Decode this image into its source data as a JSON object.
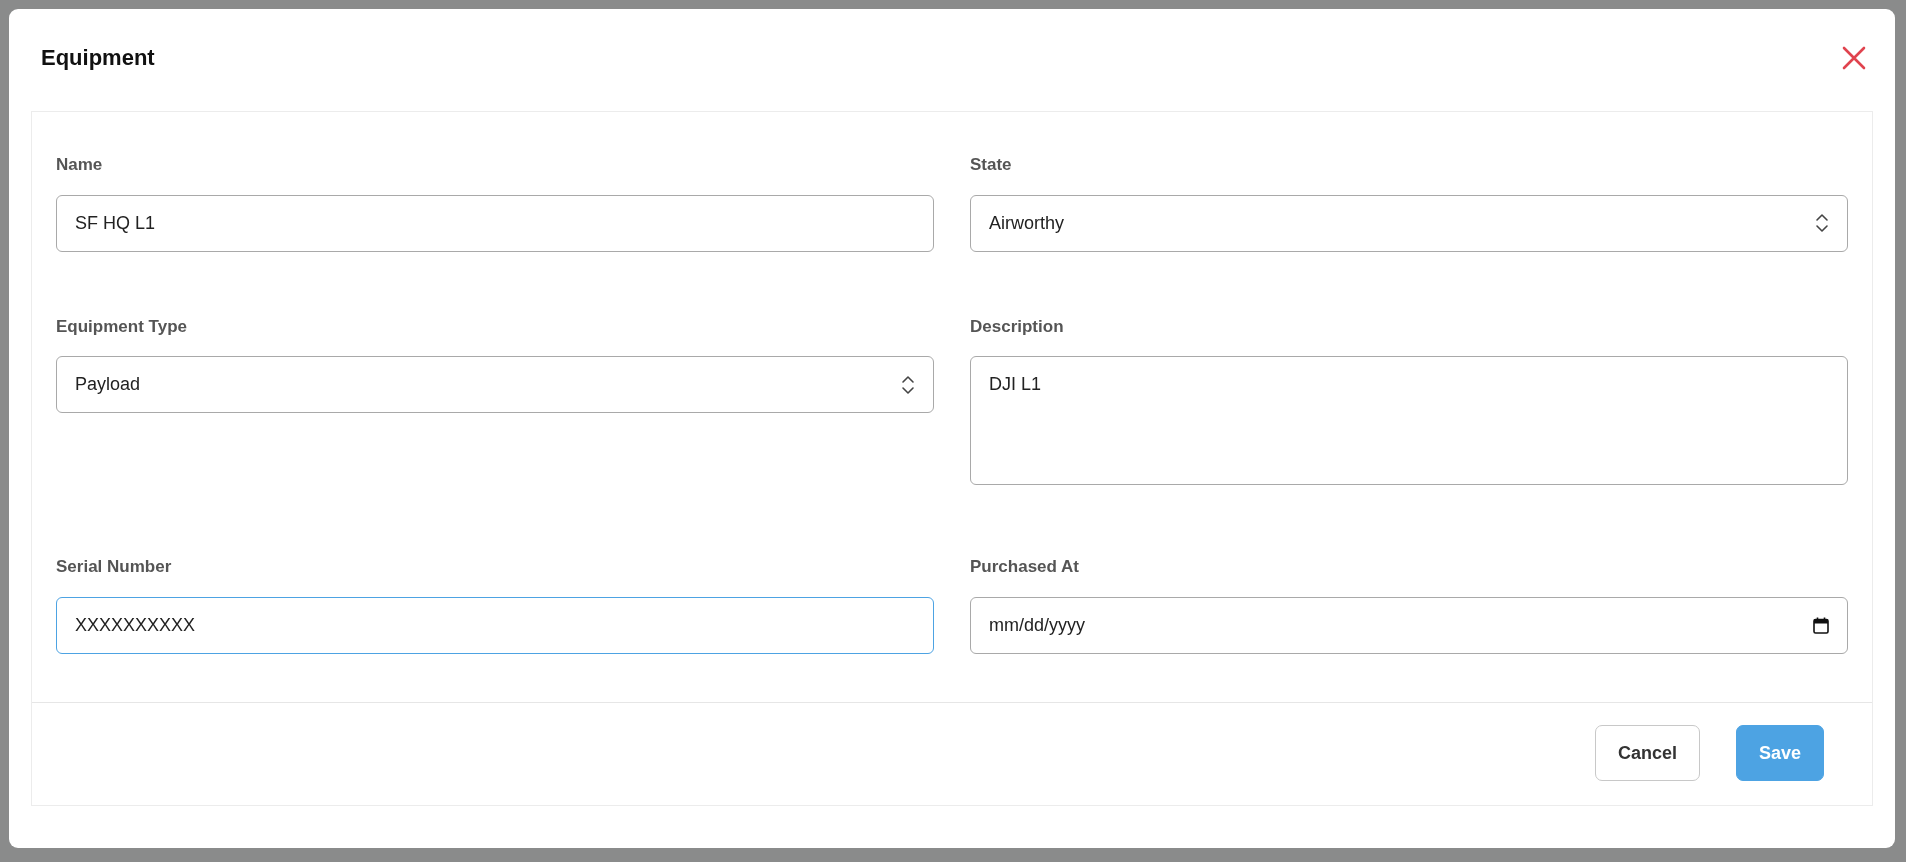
{
  "dialog": {
    "title": "Equipment"
  },
  "fields": [
    {
      "label": "Name",
      "kind": "text",
      "value": "SF HQ L1",
      "focused": false
    },
    {
      "label": "State",
      "kind": "select",
      "value": "Airworthy",
      "focused": false
    },
    {
      "label": "Equipment Type",
      "kind": "select",
      "value": "Payload",
      "focused": false
    },
    {
      "label": "Description",
      "kind": "textarea",
      "value": "DJI L1",
      "focused": false
    },
    {
      "label": "Serial Number",
      "kind": "text",
      "value": "XXXXXXXXXX",
      "focused": true
    },
    {
      "label": "Purchased At",
      "kind": "date",
      "value": "mm/dd/yyyy",
      "focused": false
    }
  ],
  "buttons": [
    {
      "label": "Cancel",
      "kind": "secondary"
    },
    {
      "label": "Save",
      "kind": "primary"
    }
  ]
}
